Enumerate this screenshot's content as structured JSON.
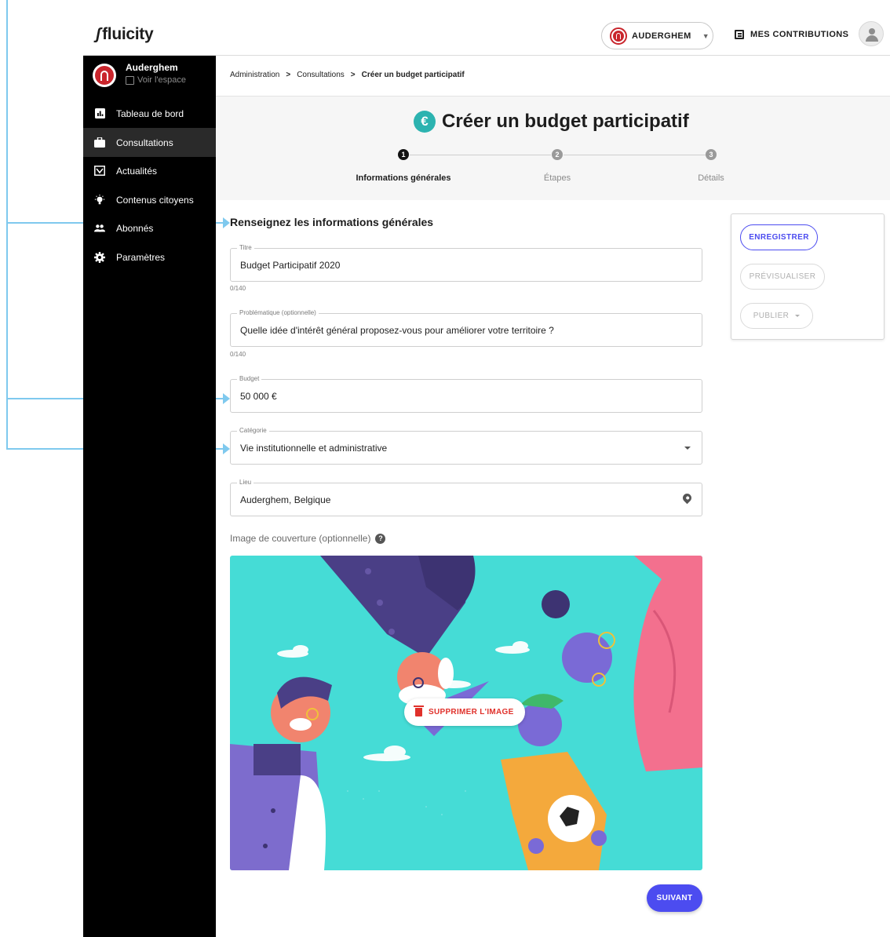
{
  "brand": {
    "logo": "fluicity",
    "mark": "ʃ"
  },
  "topbar": {
    "space_name": "AUDERGHEM",
    "contributions": "MES CONTRIBUTIONS"
  },
  "sidebar": {
    "space_name": "Auderghem",
    "view_link": "Voir l'espace",
    "items": [
      {
        "label": "Tableau de bord",
        "icon": "dashboard-icon"
      },
      {
        "label": "Consultations",
        "icon": "briefcase-icon"
      },
      {
        "label": "Actualités",
        "icon": "news-icon"
      },
      {
        "label": "Contenus citoyens",
        "icon": "lightbulb-icon"
      },
      {
        "label": "Abonnés",
        "icon": "people-icon"
      },
      {
        "label": "Paramètres",
        "icon": "gear-icon"
      }
    ]
  },
  "breadcrumb": {
    "items": [
      "Administration",
      "Consultations",
      "Créer un budget participatif"
    ],
    "separator": ">"
  },
  "page": {
    "title": "Créer un budget participatif",
    "euro_symbol": "€"
  },
  "stepper": {
    "steps": [
      {
        "num": "1",
        "label": "Informations générales"
      },
      {
        "num": "2",
        "label": "Étapes"
      },
      {
        "num": "3",
        "label": "Détails"
      }
    ]
  },
  "form": {
    "section_title": "Renseignez les informations générales",
    "title_label": "Titre",
    "title_value": "Budget Participatif 2020",
    "title_counter": "0/140",
    "problem_label": "Problématique (optionnelle)",
    "problem_value": "Quelle idée d'intérêt général proposez-vous pour améliorer votre territoire ?",
    "problem_counter": "0/140",
    "budget_label": "Budget",
    "budget_value": "50 000 €",
    "category_label": "Catégorie",
    "category_value": "Vie institutionnelle et administrative",
    "place_label": "Lieu",
    "place_value": "Auderghem, Belgique",
    "cover_label": "Image de couverture (optionnelle)",
    "help_symbol": "?",
    "delete_image": "SUPPRIMER L'IMAGE",
    "next": "SUIVANT"
  },
  "actions": {
    "save": "ENREGISTRER",
    "preview": "PRÉVISUALISER",
    "publish": "PUBLIER"
  },
  "colors": {
    "accent": "#4c4cf0",
    "teal": "#2cb3b0",
    "danger": "#e0312b",
    "annotation": "#7fc9ee"
  }
}
